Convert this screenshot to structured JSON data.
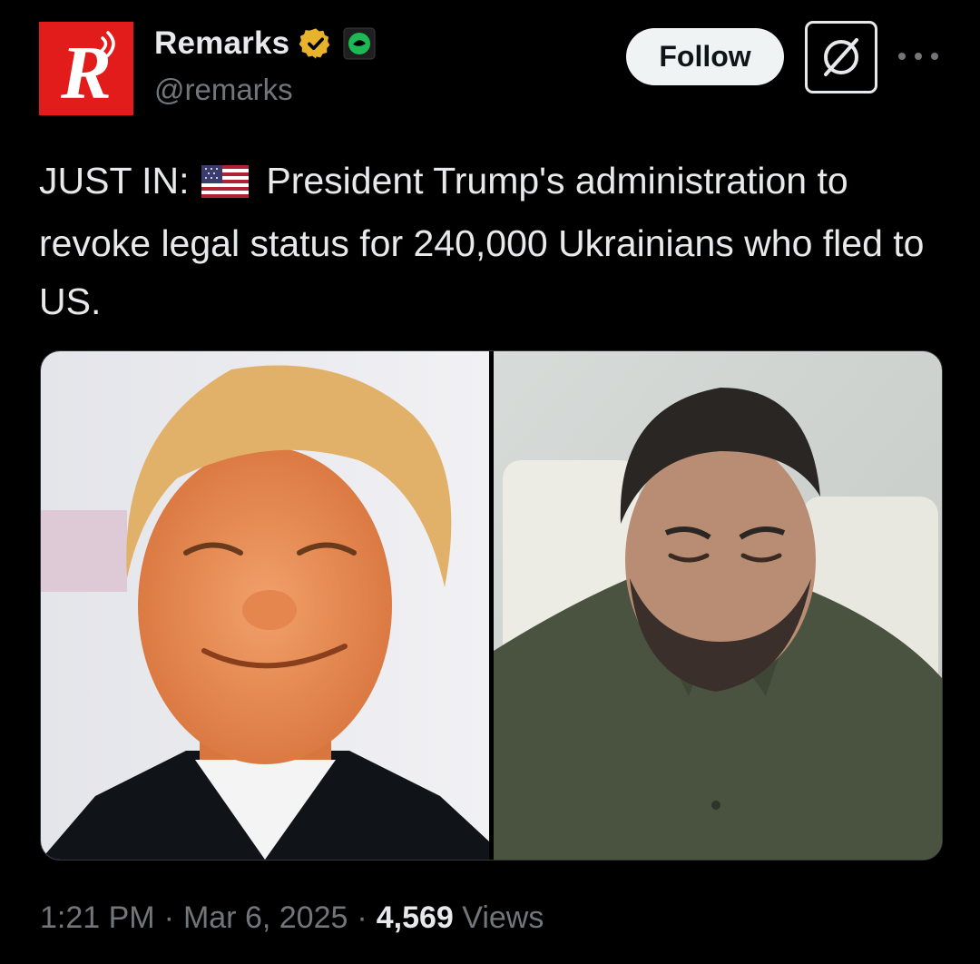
{
  "account": {
    "avatar_letter": "R",
    "display_name": "Remarks",
    "handle": "@remarks",
    "verified_badge_icon": "verified-check-icon",
    "affiliate_icon": "affiliate-logo-icon"
  },
  "actions": {
    "follow_label": "Follow",
    "grok_icon": "grok-icon",
    "more_icon": "more-options-icon"
  },
  "post": {
    "text_prefix": "JUST IN:",
    "flag_icon": "us-flag-icon",
    "text_body": "President Trump's administration to revoke legal status for 240,000 Ukrainians who fled to US."
  },
  "media": [
    {
      "kind": "photo"
    },
    {
      "kind": "photo"
    }
  ],
  "meta": {
    "time": "1:21 PM",
    "separator": "·",
    "date": "Mar 6, 2025",
    "views_count": "4,569",
    "views_label": "Views"
  },
  "colors": {
    "background": "#000000",
    "text": "#e7e9ea",
    "secondary": "#71767b",
    "avatar_red": "#e21b1b",
    "verified_gold": "#e8b32c",
    "follow_bg": "#eff3f4"
  }
}
